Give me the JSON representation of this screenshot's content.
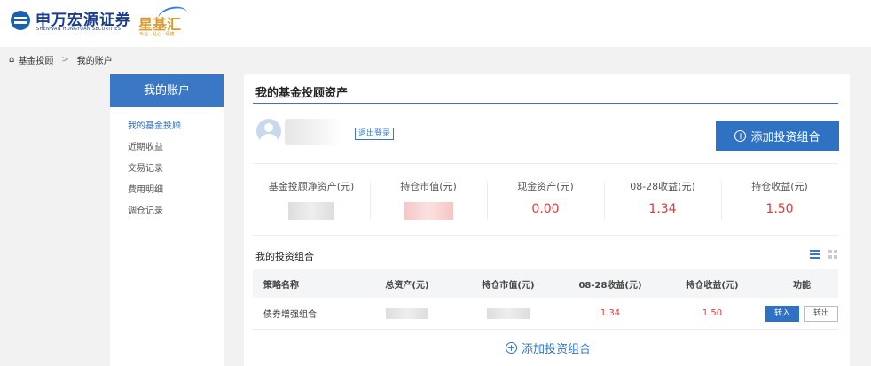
{
  "header": {
    "logo_name": "申万宏源证券",
    "logo_en": "SHENWAN HONGYUAN SECURITIES",
    "brand2_name": "星基汇",
    "brand2_slogan": "专业 · 贴心 · 便捷"
  },
  "breadcrumb": {
    "items": [
      "基金投顾",
      "我的账户"
    ],
    "separator": ">"
  },
  "sidebar": {
    "title": "我的账户",
    "items": [
      {
        "label": "我的基金投顾",
        "active": true
      },
      {
        "label": "近期收益"
      },
      {
        "label": "交易记录"
      },
      {
        "label": "费用明细"
      },
      {
        "label": "调仓记录"
      }
    ]
  },
  "main": {
    "title": "我的基金投顾资产",
    "logout_label": "退出登录",
    "add_portfolio_label": "添加投资组合",
    "stats": [
      {
        "label": "基金投顾净资产(元)",
        "value": ""
      },
      {
        "label": "持仓市值(元)",
        "value": ""
      },
      {
        "label": "现金资产(元)",
        "value": "0.00"
      },
      {
        "label": "08-28收益(元)",
        "value": "1.34"
      },
      {
        "label": "持仓收益(元)",
        "value": "1.50"
      }
    ],
    "portfolio_title": "我的投资组合",
    "table": {
      "headers": [
        "策略名称",
        "总资产(元)",
        "持仓市值(元)",
        "08-28收益(元)",
        "持仓收益(元)",
        "功能"
      ],
      "rows": [
        {
          "name": "债券增强组合",
          "total": "",
          "market": "",
          "day_profit": "1.34",
          "hold_profit": "1.50",
          "btn_in": "转入",
          "btn_out": "转出"
        }
      ]
    },
    "add_bottom_label": "添加投资组合"
  },
  "colors": {
    "accent": "#2f72c4",
    "profit_red": "#e03a3a"
  }
}
